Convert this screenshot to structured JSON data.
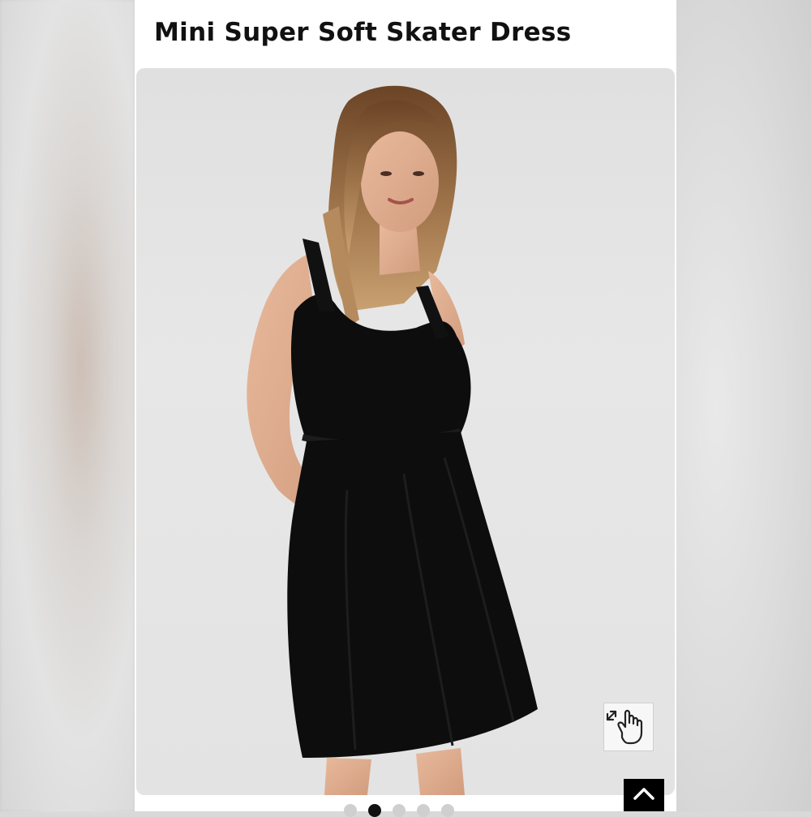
{
  "product": {
    "title": "Mini Super Soft Skater Dress",
    "image_alt": "Model wearing a black mini skater dress"
  },
  "controls": {
    "zoom_icon": "zoom-hand-icon",
    "back_to_top_icon": "chevron-up-icon"
  },
  "carousel": {
    "slide_count": 5,
    "active_index": 1
  },
  "colors": {
    "background": "#e3e3e3",
    "dress": "#0d0d0d",
    "text": "#111111",
    "accent_button": "#000000"
  }
}
